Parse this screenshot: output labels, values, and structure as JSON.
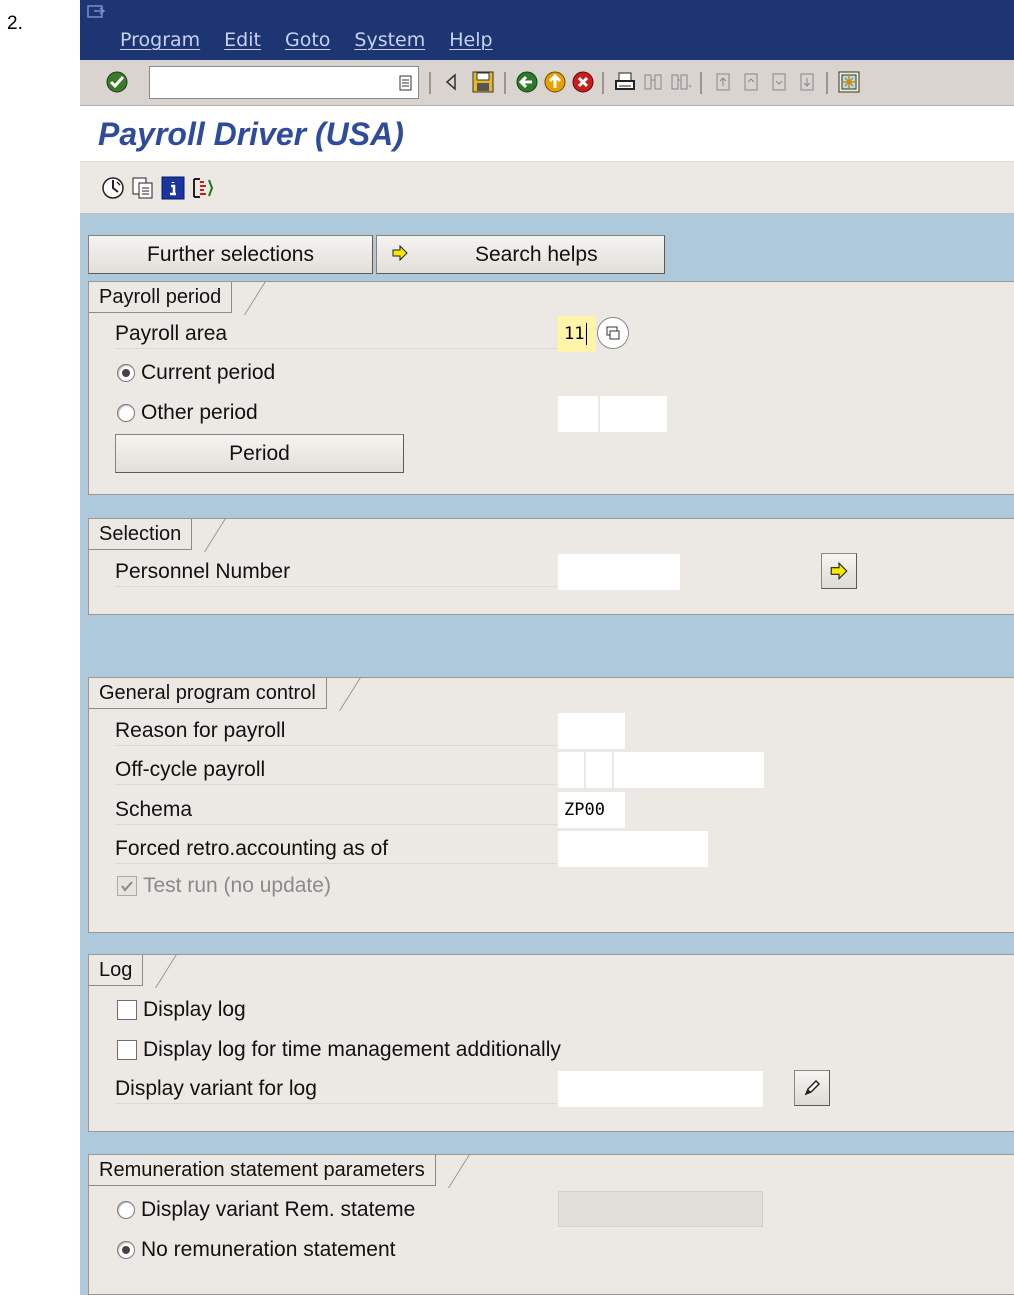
{
  "step_number": "2.",
  "menu": {
    "items": [
      "Program",
      "Edit",
      "Goto",
      "System",
      "Help"
    ]
  },
  "toolbar": {
    "command_value": "",
    "icons": [
      "enter-icon",
      "command-field",
      "back-arrow-icon",
      "save-icon",
      "back-icon",
      "exit-icon",
      "cancel-icon",
      "print-icon",
      "find-icon",
      "find-next-icon",
      "first-page-icon",
      "previous-page-icon",
      "next-page-icon",
      "last-page-icon",
      "layout-menu-icon"
    ]
  },
  "title": "Payroll Driver (USA)",
  "app_toolbar": {
    "icons": [
      "execute-icon",
      "get-variant-icon",
      "program-doc-icon",
      "selection-options-icon"
    ]
  },
  "buttons": {
    "further_selections": "Further selections",
    "search_helps": "Search helps"
  },
  "payroll_period": {
    "title": "Payroll period",
    "payroll_area_label": "Payroll area",
    "payroll_area_value": "11",
    "current_period_label": "Current period",
    "current_period_selected": true,
    "other_period_label": "Other period",
    "other_period_selected": false,
    "period_button": "Period"
  },
  "selection": {
    "title": "Selection",
    "personnel_number_label": "Personnel Number",
    "personnel_number_value": ""
  },
  "general_program_control": {
    "title": "General program control",
    "reason_label": "Reason for payroll",
    "reason_value": "",
    "off_cycle_label": "Off-cycle payroll",
    "schema_label": "Schema",
    "schema_value": "ZP00",
    "forced_retro_label": "Forced retro.accounting as of",
    "forced_retro_value": "",
    "test_run_label": "Test run (no update)",
    "test_run_checked": true
  },
  "log": {
    "title": "Log",
    "display_log_label": "Display log",
    "display_log_checked": false,
    "display_log_time_label": "Display log for time management additionally",
    "display_log_time_checked": false,
    "display_variant_label": "Display variant for log",
    "display_variant_value": ""
  },
  "remuneration": {
    "title": "Remuneration statement parameters",
    "display_variant_label": "Display variant Rem. stateme",
    "display_variant_selected": false,
    "no_statement_label": "No remuneration statement",
    "no_statement_selected": true
  },
  "colors": {
    "menubar": "#1d3573",
    "title_text": "#2f4c9c",
    "screen_background": "#aec9dc",
    "group_background": "#ece9e5",
    "highlight_field": "#fff4a8"
  }
}
